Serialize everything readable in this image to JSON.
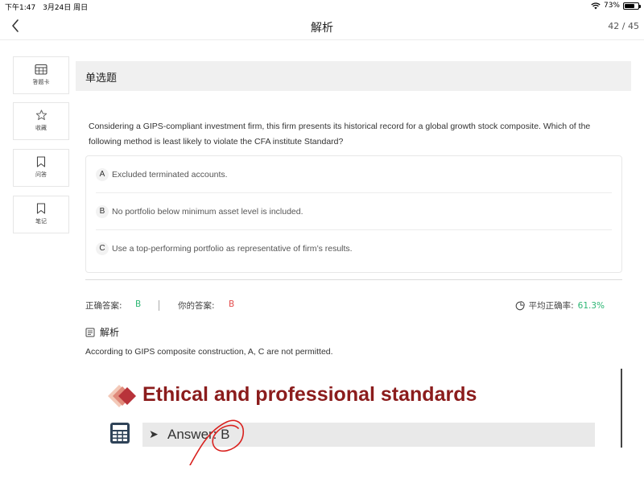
{
  "status_bar": {
    "time": "下午1:47",
    "date": "3月24日 周日",
    "battery_text": "73%",
    "battery_level": 0.73
  },
  "nav": {
    "title": "解析",
    "counter": "42 / 45",
    "back_icon": "chevron-left-icon"
  },
  "sidebar": {
    "items": [
      {
        "label": "答题卡",
        "icon": "calendar-grid-icon"
      },
      {
        "label": "收藏",
        "icon": "star-icon"
      },
      {
        "label": "问答",
        "icon": "bookmark-icon"
      },
      {
        "label": "笔记",
        "icon": "bookmark-icon"
      }
    ]
  },
  "question": {
    "type": "单选题",
    "text": "Considering a GIPS-compliant investment firm, this firm presents its historical record for a global growth stock composite. Which of the following method is least likely to violate the CFA institute Standard?",
    "options": [
      {
        "letter": "A",
        "text": "Excluded terminated accounts."
      },
      {
        "letter": "B",
        "text": "No portfolio below minimum asset level is included."
      },
      {
        "letter": "C",
        "text": "Use a top-performing portfolio as representative of firm’s results."
      }
    ]
  },
  "answers": {
    "correct_label": "正确答案:",
    "correct_value": "B",
    "yours_label": "你的答案:",
    "yours_value": "B",
    "accuracy_label": "平均正确率:",
    "accuracy_value": "61.3%",
    "correct_color": "#2bb673",
    "yours_color": "#e34b4b"
  },
  "analysis": {
    "title": "解析",
    "text": "According to GIPS composite construction, A, C are not permitted.",
    "slide_title": "Ethical and professional standards",
    "slide_answer": "Answer: B",
    "slide_title_color": "#8b1c1c"
  }
}
